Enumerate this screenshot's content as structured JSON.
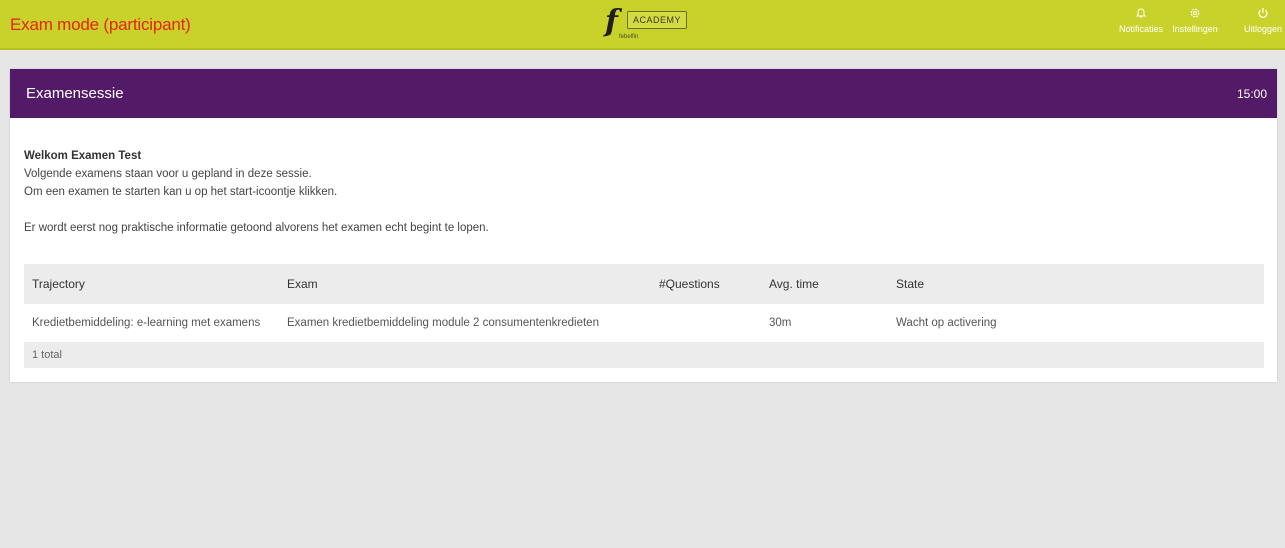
{
  "header": {
    "mode_title": "Exam mode (participant)",
    "logo_letter": "f",
    "logo_sub": "febelfin",
    "academy": "ACADEMY",
    "actions": [
      {
        "label": "Notificaties",
        "icon": "bell-icon",
        "glyph": "🔔︎"
      },
      {
        "label": "Instellingen",
        "icon": "gear-icon",
        "glyph": "⚙"
      },
      {
        "label": "Uitloggen",
        "icon": "power-icon",
        "glyph": "⏻"
      }
    ]
  },
  "session": {
    "title": "Examensessie",
    "timer": "15:00"
  },
  "intro": {
    "greeting": "Welkom Examen Test",
    "line1": "Volgende examens staan voor u gepland in deze sessie.",
    "line2": "Om een examen te starten kan u op het start-icoontje klikken.",
    "line3": "Er wordt eerst nog praktische informatie getoond alvorens het examen echt begint te lopen."
  },
  "table": {
    "columns": [
      "Trajectory",
      "Exam",
      "#Questions",
      "Avg. time",
      "State"
    ],
    "rows": [
      [
        "Kredietbemiddeling: e-learning met examens",
        "Examen kredietbemiddeling module 2 consumentenkredieten",
        "",
        "30m",
        "Wacht op activering"
      ]
    ],
    "footer": "1 total"
  },
  "colors": {
    "topbar": "#c9d22a",
    "mode_title": "#e8230c",
    "session_header": "#531a67",
    "background": "#e6e6e6"
  }
}
